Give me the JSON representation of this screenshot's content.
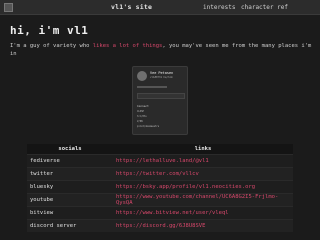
{
  "header": {
    "site_title": "vl1's site",
    "nav": [
      {
        "label": "interests"
      },
      {
        "label": "character ref"
      }
    ]
  },
  "main": {
    "heading": "hi, i'm vl1",
    "intro_before": "I'm a guy of variety who ",
    "intro_highlight": "likes a lot of things",
    "intro_after": ", you may've seen me from the many places i'm in"
  },
  "profile_card": {
    "name": "Vee Petasen",
    "subtitle": "vl1#0731 he/him",
    "rows": [
      "CLOSE",
      "tcl/0ts",
      "V/0N",
      "pilot/dosmaestro"
    ],
    "section": "Connect"
  },
  "links_table": {
    "headers": [
      "socials",
      "links"
    ],
    "rows": [
      {
        "name": "fediverse",
        "url": "https://lethalluve.land/@vl1"
      },
      {
        "name": "twitter",
        "url": "https://twitter.com/vllcv"
      },
      {
        "name": "bluesky",
        "url": "https://bsky.app/profile/vl1.neocities.org"
      },
      {
        "name": "youtube",
        "url": "https://www.youtube.com/channel/UC6A8G2I5-Frjlmo-QysQA"
      },
      {
        "name": "bitview",
        "url": "https://www.bitview.net/user/vleql"
      },
      {
        "name": "discord server",
        "url": "https://discord.gg/6J8U8SVE"
      }
    ]
  },
  "colors": {
    "background": "#1b1b1b",
    "accent": "#d9486c",
    "topbar": "#2c2c2c"
  }
}
